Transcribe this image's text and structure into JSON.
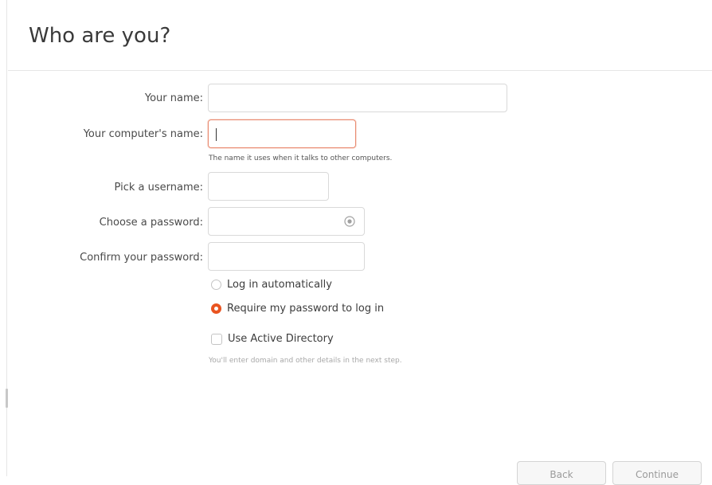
{
  "page": {
    "title": "Who are you?"
  },
  "form": {
    "your_name": {
      "label": "Your name:",
      "value": ""
    },
    "computer_name": {
      "label": "Your computer's name:",
      "value": "",
      "hint": "The name it uses when it talks to other computers."
    },
    "username": {
      "label": "Pick a username:",
      "value": ""
    },
    "password": {
      "label": "Choose a password:",
      "value": "",
      "toggle_icon": "eye-icon"
    },
    "confirm_password": {
      "label": "Confirm your password:",
      "value": ""
    }
  },
  "login": {
    "options": [
      {
        "label": "Log in automatically",
        "checked": false
      },
      {
        "label": "Require my password to log in",
        "checked": true
      }
    ]
  },
  "active_directory": {
    "label": "Use Active Directory",
    "checked": false,
    "note": "You'll enter domain and other details in the next step."
  },
  "buttons": {
    "back": "Back",
    "continue": "Continue"
  },
  "colors": {
    "accent": "#e95420",
    "focus_border": "#e98a70"
  }
}
